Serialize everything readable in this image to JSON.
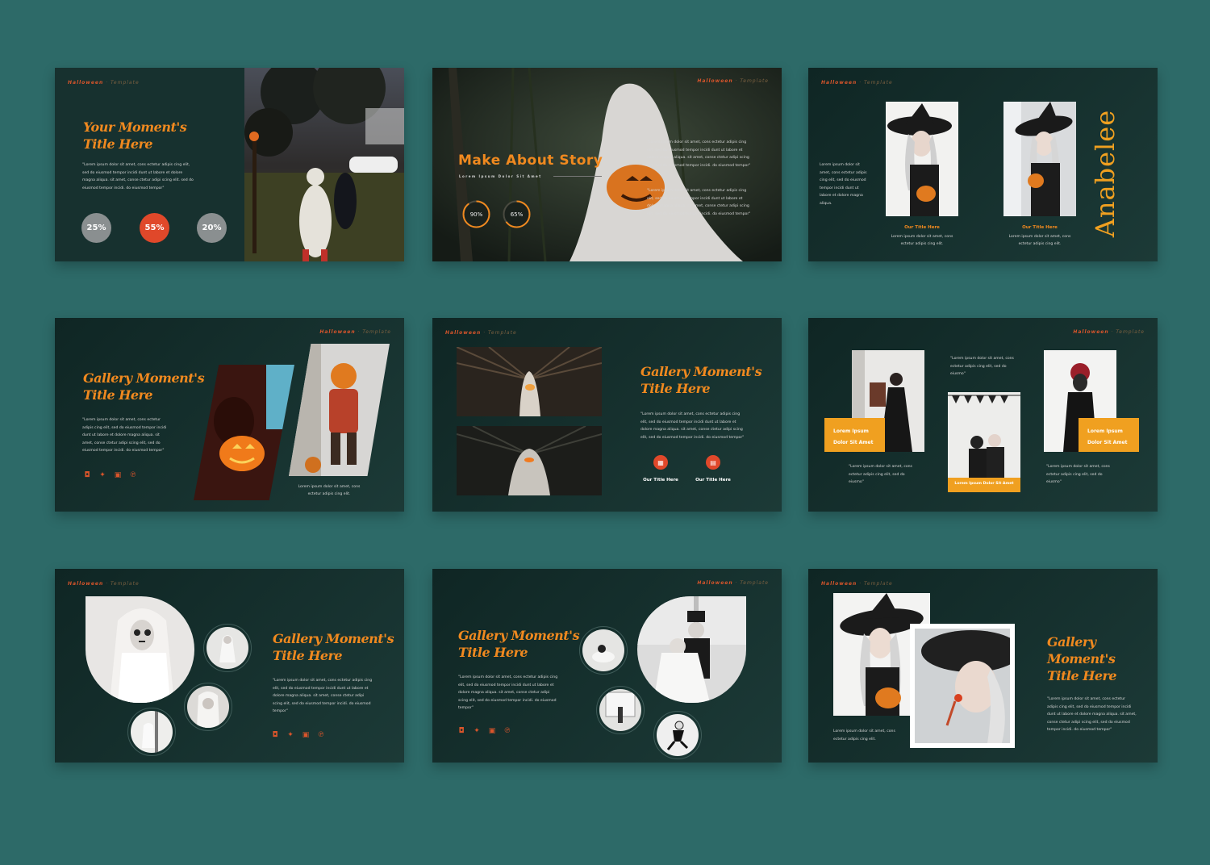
{
  "tag": {
    "word": "Halloween",
    "sep": " · ",
    "sub": "Template"
  },
  "slide1": {
    "title": "Your Moment's\nTitle Here",
    "body": "\"Lorem ipsum dolor sit amet, cons ectetur adipis cing elit, sed do eiusmod tempor incidi dunt ut labore et dolore magna aliqua. sit amet, conse ctetur adipi scing elit. sed do eiusmod tempor incidi. do eiusmod tempor\"",
    "stats": [
      "25%",
      "55%",
      "20%"
    ]
  },
  "slide2": {
    "title": "Make About Story",
    "subtitle": "Lorem Ipsum Dolor Sit Amet",
    "rings": [
      {
        "label": "90%",
        "value": 0.9
      },
      {
        "label": "65%",
        "value": 0.65
      }
    ],
    "body1": "\"Lorem ipsum dolor sit amet, cons ectetur adipis cing elit, sed do eiusmod tempor incidi dunt ut labore et dolore magna aliqua. sit amet, conse ctetur adipi scing elit, sed do eiusmod tempor incidi. do eiusmod tempor\"",
    "body2": "\"Lorem ipsum dolor sit amet, cons ectetur adipis cing elit, sed do eiusmod tempor incidi dunt ut labore et dolore magna aliqua. sit amet, conse ctetur adipi scing elit, sed do eiusmod tempor incidi. do eiusmod tempor\""
  },
  "slide3": {
    "body": "Lorem ipsum dolor sit amet, cons ectetur adipis cing elit, sed do eiusmod tempor incidi dunt ut labore et dolore magna aliqua.",
    "brand": "Anabelee",
    "items": [
      {
        "title": "Our Title Here",
        "text": "Lorem ipsum dolor sit amet, cons ectetur adipis cing elit."
      },
      {
        "title": "Our Title Here",
        "text": "Lorem ipsum dolor sit amet, cons ectetur adipis cing elit."
      }
    ]
  },
  "slide4": {
    "title": "Gallery Moment's\nTitle Here",
    "body": "\"Lorem ipsum dolor sit amet, cons ectetur adipis cing elit, sed do eiusmod tempor incidi dunt ut labore et dolore magna aliqua. sit amet, conse ctetur adipi scing elit, sed do eiusmod tempor incidi. do eiusmod tempor\"",
    "caption": "Lorem ipsum dolor sit amet, cons ectetur adipis cing elit."
  },
  "slide5": {
    "title": "Gallery Moment's\nTitle Here",
    "body": "\"Lorem ipsum dolor sit amet, cons ectetur adipis cing elit, sed do eiusmod tempor incidi dunt ut labore et dolore magna aliqua. sit amet, conse ctetur adipi scing elit, sed do eiusmod tempor incidi. do eiusmod tempor\"",
    "items": [
      {
        "label": "Our Title Here"
      },
      {
        "label": "Our Title Here"
      }
    ]
  },
  "slide6": {
    "box1": "Lorem Ipsum\nDolor Sit Amet",
    "box2": "Lorem Ipsum\nDolor Sit Amet",
    "box3": "Lorem Ipsum Dolor Sit Amet",
    "text_top": "\"Lorem ipsum dolor sit amet, cons ectetur adipis cing elit, sed do eiusmo\"",
    "text_left": "\"Lorem ipsum dolor sit amet, cons ectetur adipis cing elit, sed do eiusmo\"",
    "text_right": "\"Lorem ipsum dolor sit amet, cons ectetur adipis cing elit, sed do eiusmo\""
  },
  "slide7": {
    "title": "Gallery Moment's\nTitle Here",
    "body": "\"Lorem ipsum dolor sit amet, cons ectetur adipis cing elit, sed do eiusmod tempor incidi dunt ut labore et dolore magna aliqua. sit amet, conse ctetur adipi scing elit, sed do eiusmod tempor incidi. do eiusmod tempor\""
  },
  "slide8": {
    "title": "Gallery Moment's\nTitle Here",
    "body": "\"Lorem ipsum dolor sit amet, cons ectetur adipis cing elit, sed do eiusmod tempor incidi dunt ut labore et dolore magna aliqua. sit amet, conse ctetur adipi scing elit, sed do eiusmod tempor incidi. do eiusmod tempor\""
  },
  "slide9": {
    "title": "Gallery\nMoment's\nTitle Here",
    "body": "\"Lorem ipsum dolor sit amet, cons ectetur adipis cing elit, sed do eiusmod tempor incidi dunt ut labore et dolore magna aliqua. sit amet, conse ctetur adipi scing elit, sed do eiusmod tempor incidi. do eiusmod tempor\"",
    "caption": "Lorem ipsum dolor sit amet, cons ectetur adipis cing elit."
  },
  "social_icons": [
    "instagram-icon",
    "twitter-icon",
    "facebook-icon",
    "pinterest-icon"
  ],
  "colors": {
    "background": "#2d6a68",
    "slide": "#17312f",
    "accent": "#f0891f",
    "red": "#e0482a",
    "grey_stat": "#8a8f90"
  }
}
